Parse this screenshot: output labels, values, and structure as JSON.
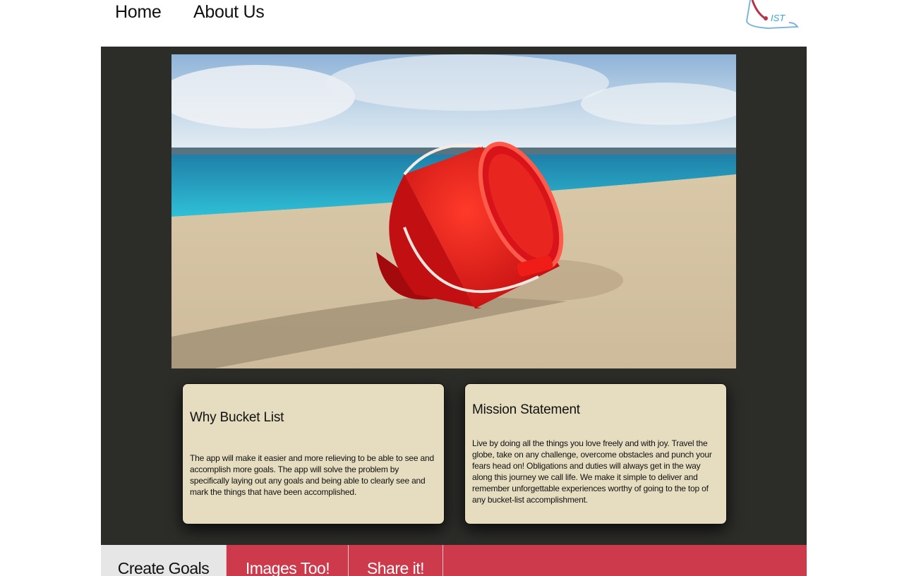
{
  "nav": {
    "home_label": "Home",
    "about_label": "About Us"
  },
  "logo": {
    "text": "IST",
    "icon": "bucket-list-logo-icon"
  },
  "hero": {
    "icon": "beach-bucket-image"
  },
  "cards": [
    {
      "title": "Why Bucket List",
      "body": "The app will make it easier and more relieving to be able to see and accomplish more goals. The app will solve the problem by specifically laying out any goals and being able to clearly see and mark the things that have been accomplished."
    },
    {
      "title": "Mission Statement",
      "body": "Live by doing all the things you love freely and with joy. Travel the globe, take on any challenge, overcome obstacles and punch your fears head on! Obligations and duties will always get in the way along this journey we call life. We make it simple to deliver and remember unforgettable experiences worthy of going to the top of any bucket-list accomplishment."
    }
  ],
  "tabs": {
    "create_label": "Create Goals",
    "images_label": "Images Too!",
    "share_label": "Share it!"
  },
  "colors": {
    "panel": "#2c2c29",
    "card": "#e6ddc0",
    "tab_bar": "#cc3a4c",
    "tab_active": "#e6e6e6"
  }
}
